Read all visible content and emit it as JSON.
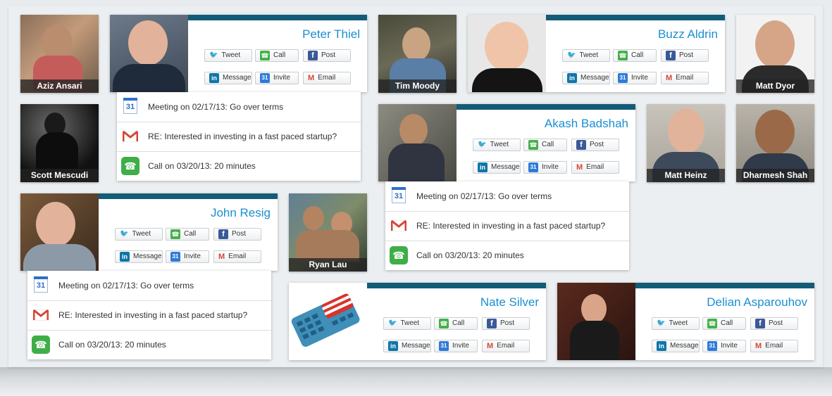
{
  "labels": {
    "tweet": "Tweet",
    "call": "Call",
    "post": "Post",
    "message": "Message",
    "invite": "Invite",
    "email": "Email"
  },
  "activity": {
    "meeting": "Meeting on 02/17/13: Go over terms",
    "email_subject": "RE: Interested in investing in a fast paced startup?",
    "call": "Call on 03/20/13: 20 minutes"
  },
  "people": {
    "aziz": "Aziz Ansari",
    "peter": "Peter Thiel",
    "tim": "Tim Moody",
    "buzz": "Buzz Aldrin",
    "matt_dyor": "Matt Dyor",
    "scott": "Scott Mescudi",
    "akash": "Akash Badshah",
    "matt_heinz": "Matt Heinz",
    "dharmesh": "Dharmesh Shah",
    "john": "John Resig",
    "ryan": "Ryan Lau",
    "nate": "Nate Silver",
    "delian": "Delian Asparouhov"
  },
  "icons": {
    "tweet": "twitter-bird-icon",
    "call": "phone-icon",
    "post": "facebook-icon",
    "message": "linkedin-icon",
    "invite": "calendar-icon",
    "email": "gmail-icon"
  },
  "colors": {
    "accent_bar": "#125c78",
    "name_blue": "#1a8fd1",
    "name_band": "#232323"
  }
}
